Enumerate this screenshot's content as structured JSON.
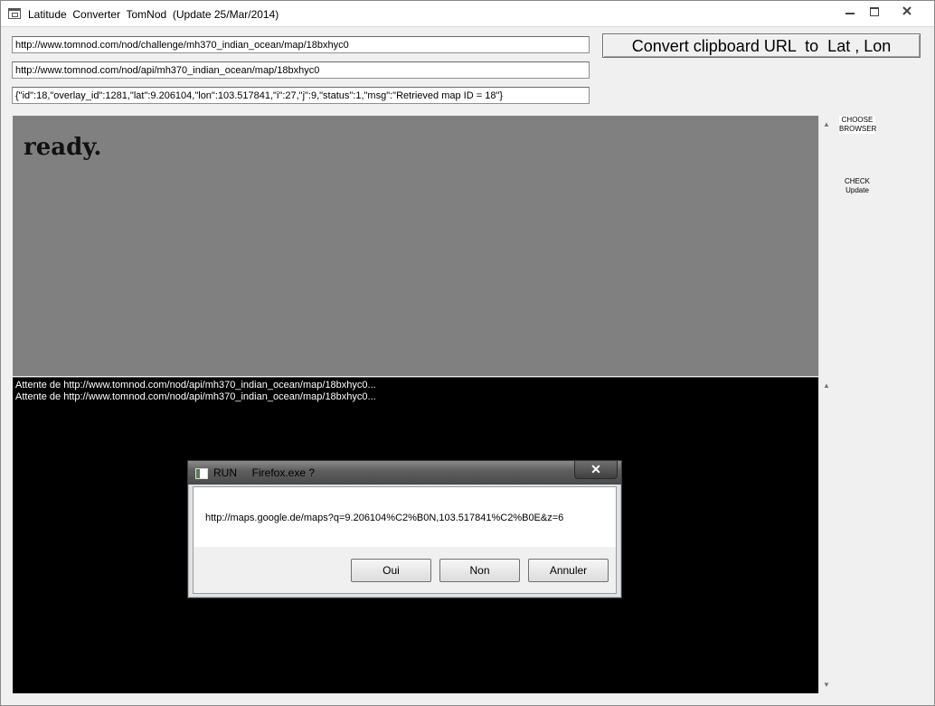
{
  "window": {
    "title": "Latitude  Converter  TomNod  (Update 25/Mar/2014)",
    "icon": "app-window-icon",
    "controls": [
      "minimize-icon",
      "maximize-icon",
      "close-icon"
    ]
  },
  "fields": {
    "challenge_url": "http://www.tomnod.com/nod/challenge/mh370_indian_ocean/map/18bxhyc0",
    "api_url": "http://www.tomnod.com/nod/api/mh370_indian_ocean/map/18bxhyc0",
    "json_response": "{\"id\":18,\"overlay_id\":1281,\"lat\":9.206104,\"lon\":103.517841,\"i\":27,\"j\":9,\"status\":1,\"msg\":\"Retrieved map ID = 18\"}"
  },
  "toolbar": {
    "convert_label": "Convert clipboard URL  to  Lat , Lon",
    "choose_browser_line1": "CHOOSE",
    "choose_browser_line2": "BROWSER",
    "check_update_line1": "CHECK",
    "check_update_line2": "Update"
  },
  "browser": {
    "status_text": "ready."
  },
  "log": {
    "lines": [
      "Attente de http://www.tomnod.com/nod/api/mh370_indian_ocean/map/18bxhyc0...",
      "Attente de http://www.tomnod.com/nod/api/mh370_indian_ocean/map/18bxhyc0..."
    ]
  },
  "dialog": {
    "title": "RUN     Firefox.exe ?",
    "close_glyph": "✕",
    "message": "http://maps.google.de/maps?q=9.206104%C2%B0N,103.517841%C2%B0E&z=6",
    "buttons": {
      "yes": "Oui",
      "no": "Non",
      "cancel": "Annuler"
    }
  },
  "colors": {
    "browser_background": "#808080",
    "log_background": "#000000",
    "log_text": "#ffffff",
    "window_background": "#f0f0f0"
  }
}
